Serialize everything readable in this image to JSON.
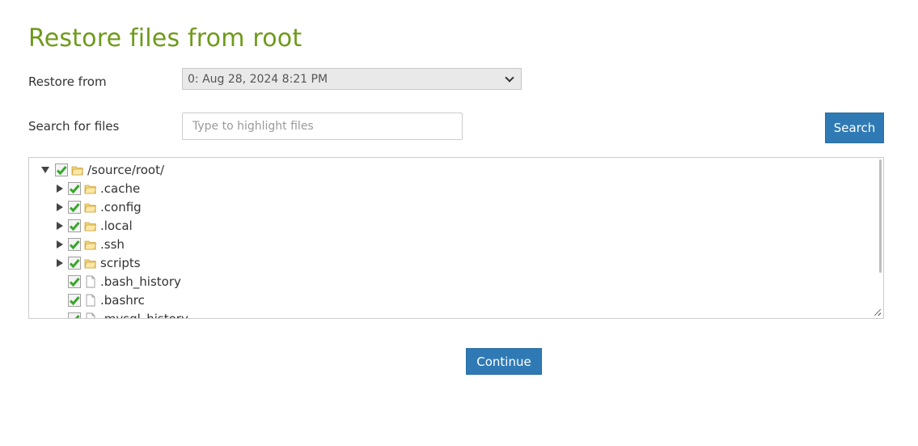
{
  "page": {
    "title": "Restore files from root"
  },
  "restore_from": {
    "label": "Restore from",
    "selected": "0: Aug 28, 2024 8:21 PM"
  },
  "search": {
    "label": "Search for files",
    "placeholder": "Type to highlight files",
    "button_label": "Search"
  },
  "tree": {
    "root": {
      "label": "/source/root/",
      "expanded": true,
      "checked": true,
      "icon": "folder-open-icon"
    },
    "items": [
      {
        "label": ".cache",
        "type": "folder",
        "checked": true,
        "icon": "folder-icon"
      },
      {
        "label": ".config",
        "type": "folder",
        "checked": true,
        "icon": "folder-icon"
      },
      {
        "label": ".local",
        "type": "folder",
        "checked": true,
        "icon": "folder-icon"
      },
      {
        "label": ".ssh",
        "type": "folder",
        "checked": true,
        "icon": "folder-icon"
      },
      {
        "label": "scripts",
        "type": "folder",
        "checked": true,
        "icon": "folder-icon"
      },
      {
        "label": ".bash_history",
        "type": "file",
        "checked": true,
        "icon": "file-icon"
      },
      {
        "label": ".bashrc",
        "type": "file",
        "checked": true,
        "icon": "file-icon"
      },
      {
        "label": ".mysql_history",
        "type": "file",
        "checked": true,
        "icon": "file-icon"
      }
    ]
  },
  "actions": {
    "continue_label": "Continue"
  },
  "colors": {
    "title": "#6f9a1b",
    "button": "#2f7ab5",
    "check": "#3aa62c"
  }
}
